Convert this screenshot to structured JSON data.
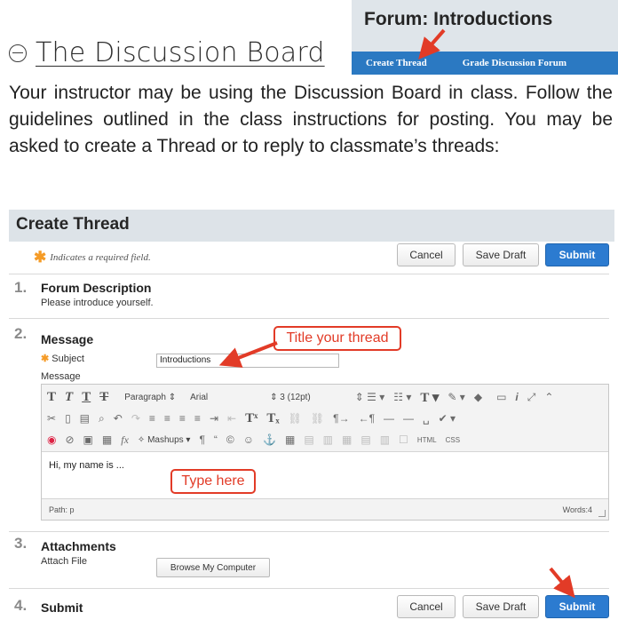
{
  "heading": {
    "title": "The Discussion Board"
  },
  "forum": {
    "title": "Forum: Introductions",
    "actions": [
      "Create Thread",
      "Grade Discussion Forum"
    ]
  },
  "intro": {
    "text": "Your instructor may be using the Discussion Board in class. Follow the guidelines outlined in the class instructions for posting.  You may be asked to create a Thread or to reply to classmate’s threads:"
  },
  "create_thread": {
    "title": "Create Thread",
    "required_note": "Indicates a required field.",
    "buttons": {
      "cancel": "Cancel",
      "save_draft": "Save Draft",
      "submit": "Submit"
    },
    "steps": [
      {
        "num": "1.",
        "title": "Forum Description",
        "text": "Please introduce yourself."
      },
      {
        "num": "2.",
        "title": "Message"
      },
      {
        "num": "3.",
        "title": "Attachments"
      },
      {
        "num": "4.",
        "title": "Submit"
      }
    ],
    "subject": {
      "label": "Subject",
      "value": "Introductions"
    },
    "message_label": "Message",
    "toolbar": {
      "paragraph": "Paragraph",
      "font": "Arial",
      "size": "3 (12pt)",
      "mashups": "Mashups",
      "html": "HTML",
      "css": "CSS"
    },
    "body_text": "Hi, my name is ...",
    "path": "Path: p",
    "words": "Words:4",
    "attach_label": "Attach File",
    "browse": "Browse My Computer"
  },
  "annotations": {
    "title_thread": "Title your thread",
    "type_here": "Type here"
  },
  "colors": {
    "accent_blue": "#2c7bd0",
    "annotation_red": "#e23b27",
    "required_orange": "#f59b26",
    "header_gray": "#dde3e8"
  }
}
